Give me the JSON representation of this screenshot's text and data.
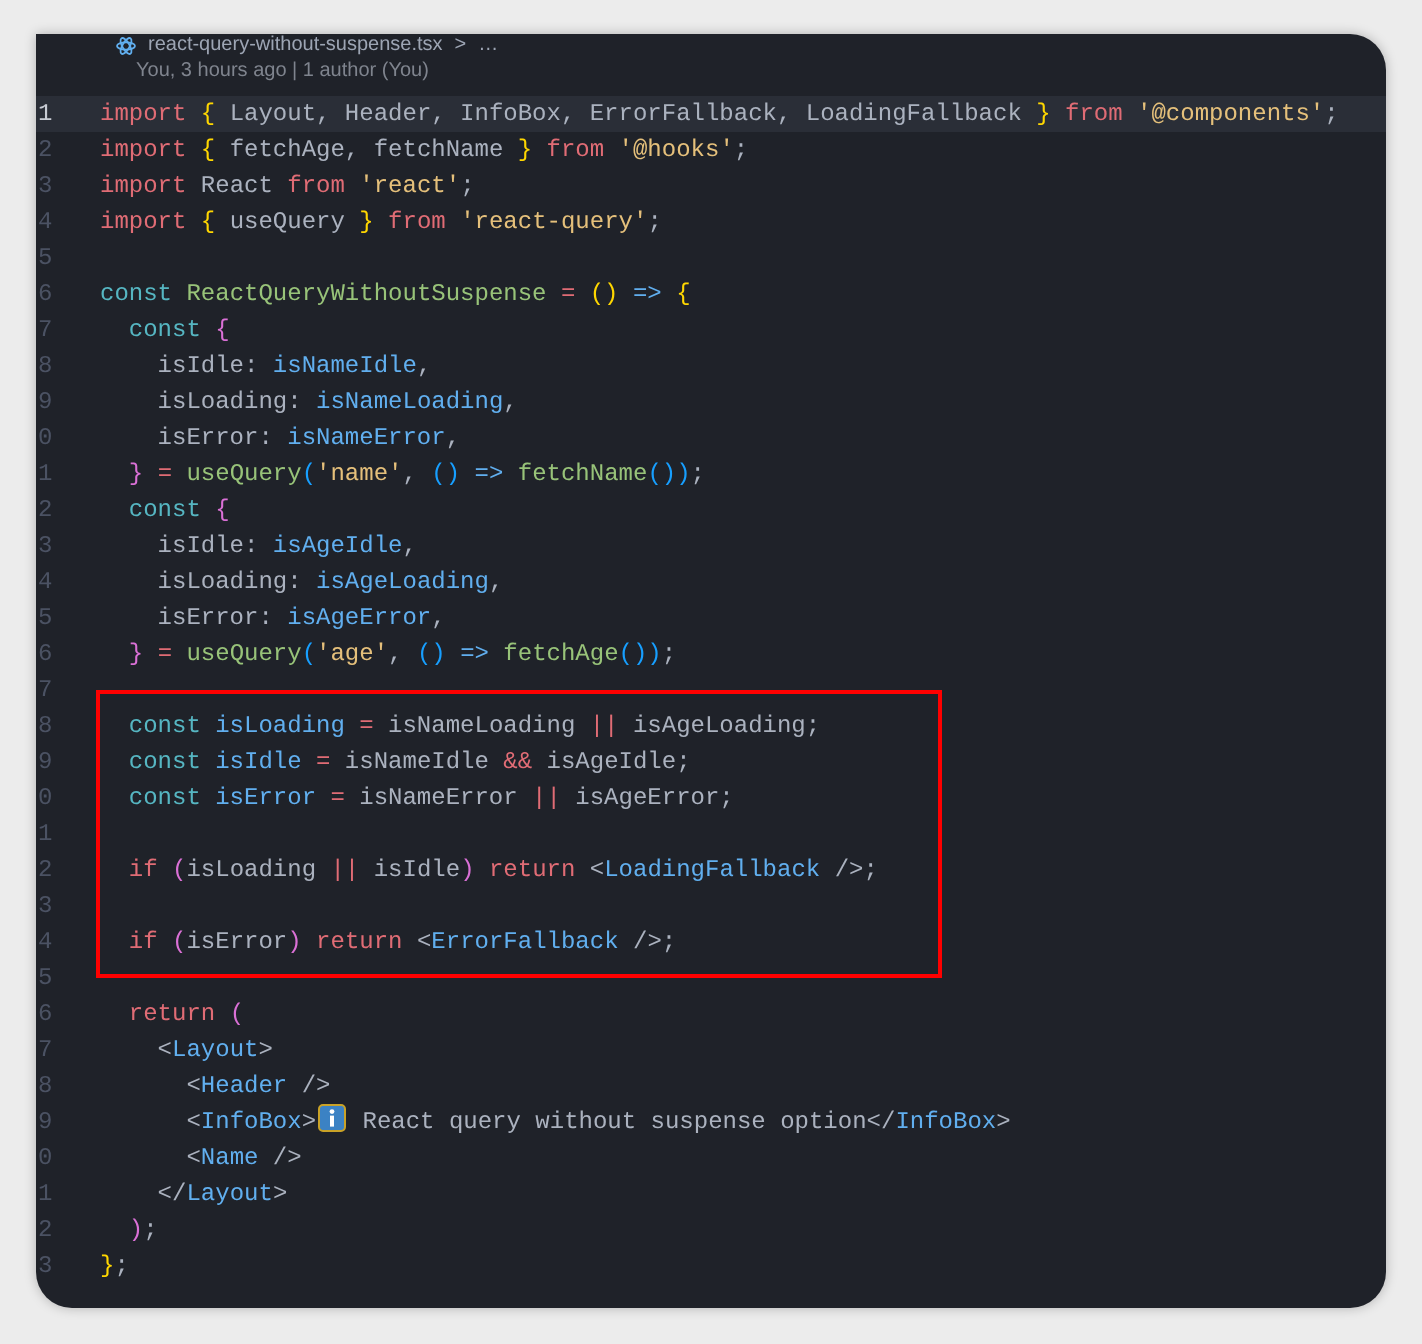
{
  "breadcrumb": {
    "file": "react-query-without-suspense.tsx",
    "separator": ">",
    "more": "…"
  },
  "codelens": "You, 3 hours ago | 1 author (You)",
  "blocks": [
    {
      "highlighted": false,
      "lines": [
        {
          "number": "1",
          "current": true,
          "tokens": [
            {
              "kind": "kw",
              "text": "import "
            },
            {
              "kind": "b1",
              "text": "{"
            },
            {
              "kind": "plain",
              "text": " Layout, Header, InfoBox, ErrorFallback, LoadingFallback "
            },
            {
              "kind": "b1",
              "text": "} "
            },
            {
              "kind": "kw",
              "text": "from "
            },
            {
              "kind": "str",
              "text": "'@components'"
            },
            {
              "kind": "plain",
              "text": ";"
            }
          ]
        },
        {
          "number": "2",
          "current": false,
          "tokens": [
            {
              "kind": "kw",
              "text": "import "
            },
            {
              "kind": "b1",
              "text": "{"
            },
            {
              "kind": "plain",
              "text": " fetchAge, fetchName "
            },
            {
              "kind": "b1",
              "text": "} "
            },
            {
              "kind": "kw",
              "text": "from "
            },
            {
              "kind": "str",
              "text": "'@hooks'"
            },
            {
              "kind": "plain",
              "text": ";"
            }
          ]
        },
        {
          "number": "3",
          "current": false,
          "tokens": [
            {
              "kind": "kw",
              "text": "import"
            },
            {
              "kind": "plain",
              "text": " React "
            },
            {
              "kind": "kw",
              "text": "from "
            },
            {
              "kind": "str",
              "text": "'react'"
            },
            {
              "kind": "plain",
              "text": ";"
            }
          ]
        },
        {
          "number": "4",
          "current": false,
          "tokens": [
            {
              "kind": "kw",
              "text": "import "
            },
            {
              "kind": "b1",
              "text": "{"
            },
            {
              "kind": "plain",
              "text": " useQuery "
            },
            {
              "kind": "b1",
              "text": "} "
            },
            {
              "kind": "kw",
              "text": "from "
            },
            {
              "kind": "str",
              "text": "'react-query'"
            },
            {
              "kind": "plain",
              "text": ";"
            }
          ]
        },
        {
          "number": "5",
          "current": false
        },
        {
          "number": "6",
          "current": false,
          "tokens": [
            {
              "kind": "const",
              "text": "const "
            },
            {
              "kind": "fn",
              "text": "ReactQueryWithoutSuspense "
            },
            {
              "kind": "kw",
              "text": "= "
            },
            {
              "kind": "b1",
              "text": "() "
            },
            {
              "kind": "var",
              "text": "=> "
            },
            {
              "kind": "b1",
              "text": "{"
            }
          ]
        },
        {
          "number": "7",
          "current": false,
          "tokens": [
            {
              "kind": "const",
              "text": "  const "
            },
            {
              "kind": "b2",
              "text": "{"
            }
          ]
        },
        {
          "number": "8",
          "current": false,
          "tokens": [
            {
              "kind": "plain",
              "text": "    isIdle: "
            },
            {
              "kind": "var",
              "text": "isNameIdle"
            },
            {
              "kind": "plain",
              "text": ","
            }
          ]
        },
        {
          "number": "9",
          "current": false,
          "tokens": [
            {
              "kind": "plain",
              "text": "    isLoading: "
            },
            {
              "kind": "var",
              "text": "isNameLoading"
            },
            {
              "kind": "plain",
              "text": ","
            }
          ]
        },
        {
          "number": "0",
          "current": false,
          "tokens": [
            {
              "kind": "plain",
              "text": "    isError: "
            },
            {
              "kind": "var",
              "text": "isNameError"
            },
            {
              "kind": "plain",
              "text": ","
            }
          ]
        },
        {
          "number": "1",
          "current": false,
          "tokens": [
            {
              "kind": "b2",
              "text": "  } "
            },
            {
              "kind": "kw",
              "text": "= "
            },
            {
              "kind": "fn",
              "text": "useQuery"
            },
            {
              "kind": "b3",
              "text": "("
            },
            {
              "kind": "str",
              "text": "'name'"
            },
            {
              "kind": "plain",
              "text": ", "
            },
            {
              "kind": "b3",
              "text": "() "
            },
            {
              "kind": "var",
              "text": "=> "
            },
            {
              "kind": "fn",
              "text": "fetchName"
            },
            {
              "kind": "b3",
              "text": "())"
            },
            {
              "kind": "plain",
              "text": ";"
            }
          ]
        },
        {
          "number": "2",
          "current": false,
          "tokens": [
            {
              "kind": "const",
              "text": "  const "
            },
            {
              "kind": "b2",
              "text": "{"
            }
          ]
        },
        {
          "number": "3",
          "current": false,
          "tokens": [
            {
              "kind": "plain",
              "text": "    isIdle: "
            },
            {
              "kind": "var",
              "text": "isAgeIdle"
            },
            {
              "kind": "plain",
              "text": ","
            }
          ]
        },
        {
          "number": "4",
          "current": false,
          "tokens": [
            {
              "kind": "plain",
              "text": "    isLoading: "
            },
            {
              "kind": "var",
              "text": "isAgeLoading"
            },
            {
              "kind": "plain",
              "text": ","
            }
          ]
        },
        {
          "number": "5",
          "current": false,
          "tokens": [
            {
              "kind": "plain",
              "text": "    isError: "
            },
            {
              "kind": "var",
              "text": "isAgeError"
            },
            {
              "kind": "plain",
              "text": ","
            }
          ]
        },
        {
          "number": "6",
          "current": false,
          "tokens": [
            {
              "kind": "b2",
              "text": "  } "
            },
            {
              "kind": "kw",
              "text": "= "
            },
            {
              "kind": "fn",
              "text": "useQuery"
            },
            {
              "kind": "b3",
              "text": "("
            },
            {
              "kind": "str",
              "text": "'age'"
            },
            {
              "kind": "plain",
              "text": ", "
            },
            {
              "kind": "b3",
              "text": "() "
            },
            {
              "kind": "var",
              "text": "=> "
            },
            {
              "kind": "fn",
              "text": "fetchAge"
            },
            {
              "kind": "b3",
              "text": "())"
            },
            {
              "kind": "plain",
              "text": ";"
            }
          ]
        }
      ]
    },
    {
      "highlighted": true,
      "lines": [
        {
          "number": "7",
          "current": false
        },
        {
          "number": "8",
          "current": false,
          "tokens": [
            {
              "kind": "const",
              "text": "  const "
            },
            {
              "kind": "var",
              "text": "isLoading "
            },
            {
              "kind": "kw",
              "text": "="
            },
            {
              "kind": "plain",
              "text": " isNameLoading "
            },
            {
              "kind": "kw",
              "text": "||"
            },
            {
              "kind": "plain",
              "text": " isAgeLoading;"
            }
          ]
        },
        {
          "number": "9",
          "current": false,
          "tokens": [
            {
              "kind": "const",
              "text": "  const "
            },
            {
              "kind": "var",
              "text": "isIdle "
            },
            {
              "kind": "kw",
              "text": "="
            },
            {
              "kind": "plain",
              "text": " isNameIdle "
            },
            {
              "kind": "kw",
              "text": "&&"
            },
            {
              "kind": "plain",
              "text": " isAgeIdle;"
            }
          ]
        },
        {
          "number": "0",
          "current": false,
          "tokens": [
            {
              "kind": "const",
              "text": "  const "
            },
            {
              "kind": "var",
              "text": "isError "
            },
            {
              "kind": "kw",
              "text": "="
            },
            {
              "kind": "plain",
              "text": " isNameError "
            },
            {
              "kind": "kw",
              "text": "||"
            },
            {
              "kind": "plain",
              "text": " isAgeError;"
            }
          ]
        },
        {
          "number": "1",
          "current": false
        },
        {
          "number": "2",
          "current": false,
          "tokens": [
            {
              "kind": "kw",
              "text": "  if "
            },
            {
              "kind": "b2",
              "text": "("
            },
            {
              "kind": "plain",
              "text": "isLoading "
            },
            {
              "kind": "kw",
              "text": "||"
            },
            {
              "kind": "plain",
              "text": " isIdle"
            },
            {
              "kind": "b2",
              "text": ") "
            },
            {
              "kind": "kw",
              "text": "return"
            },
            {
              "kind": "plain",
              "text": " <"
            },
            {
              "kind": "var",
              "text": "LoadingFallback"
            },
            {
              "kind": "plain",
              "text": " />;"
            }
          ]
        },
        {
          "number": "3",
          "current": false
        },
        {
          "number": "4",
          "current": false,
          "tokens": [
            {
              "kind": "kw",
              "text": "  if "
            },
            {
              "kind": "b2",
              "text": "("
            },
            {
              "kind": "plain",
              "text": "isError"
            },
            {
              "kind": "b2",
              "text": ") "
            },
            {
              "kind": "kw",
              "text": "return"
            },
            {
              "kind": "plain",
              "text": " <"
            },
            {
              "kind": "var",
              "text": "ErrorFallback"
            },
            {
              "kind": "plain",
              "text": " />;"
            }
          ]
        },
        {
          "number": "5",
          "current": false
        }
      ]
    },
    {
      "highlighted": false,
      "lines": [
        {
          "number": "6",
          "current": false,
          "tokens": [
            {
              "kind": "kw",
              "text": "  return "
            },
            {
              "kind": "b2",
              "text": "("
            }
          ]
        },
        {
          "number": "7",
          "current": false,
          "tokens": [
            {
              "kind": "plain",
              "text": "    <"
            },
            {
              "kind": "var",
              "text": "Layout"
            },
            {
              "kind": "plain",
              "text": ">"
            }
          ]
        },
        {
          "number": "8",
          "current": false,
          "tokens": [
            {
              "kind": "plain",
              "text": "      <"
            },
            {
              "kind": "var",
              "text": "Header"
            },
            {
              "kind": "plain",
              "text": " />"
            }
          ]
        },
        {
          "number": "9",
          "current": false,
          "tokens": [
            {
              "kind": "plain",
              "text": "      <"
            },
            {
              "kind": "var",
              "text": "InfoBox"
            },
            {
              "kind": "plain",
              "text": ">"
            },
            {
              "kind": "info_icon"
            },
            {
              "kind": "plain",
              "text": " React query without suspense option</"
            },
            {
              "kind": "var",
              "text": "InfoBox"
            },
            {
              "kind": "plain",
              "text": ">"
            }
          ]
        },
        {
          "number": "0",
          "current": false,
          "tokens": [
            {
              "kind": "plain",
              "text": "      <"
            },
            {
              "kind": "var",
              "text": "Name"
            },
            {
              "kind": "plain",
              "text": " />"
            }
          ]
        },
        {
          "number": "1",
          "current": false,
          "tokens": [
            {
              "kind": "plain",
              "text": "    </"
            },
            {
              "kind": "var",
              "text": "Layout"
            },
            {
              "kind": "plain",
              "text": ">"
            }
          ]
        },
        {
          "number": "2",
          "current": false,
          "tokens": [
            {
              "kind": "b2",
              "text": "  )"
            },
            {
              "kind": "plain",
              "text": ";"
            }
          ]
        },
        {
          "number": "3",
          "current": false,
          "tokens": [
            {
              "kind": "b1",
              "text": "}"
            },
            {
              "kind": "plain",
              "text": ";"
            }
          ]
        }
      ]
    }
  ]
}
